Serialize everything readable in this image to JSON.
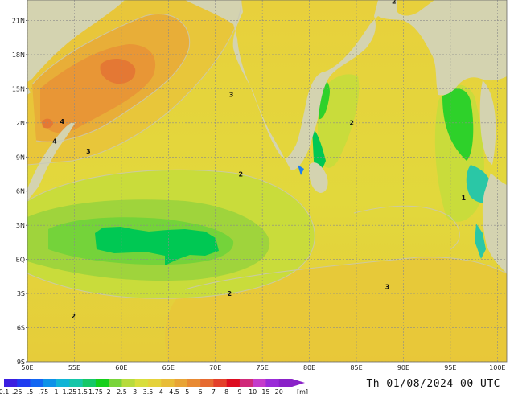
{
  "map": {
    "lat_labels": [
      "21N",
      "18N",
      "15N",
      "12N",
      "9N",
      "6N",
      "3N",
      "EQ",
      "3S",
      "6S",
      "9S"
    ],
    "lon_labels": [
      "50E",
      "55E",
      "60E",
      "65E",
      "70E",
      "75E",
      "80E",
      "85E",
      "90E",
      "95E",
      "100E"
    ],
    "contour_labels": [
      {
        "text": "2",
        "lon": 89.0,
        "lat": 22.5
      },
      {
        "text": "3",
        "lon": 71.7,
        "lat": 14.3
      },
      {
        "text": "2",
        "lon": 84.5,
        "lat": 11.8
      },
      {
        "text": "4",
        "lon": 53.7,
        "lat": 11.9
      },
      {
        "text": "4",
        "lon": 52.9,
        "lat": 10.2
      },
      {
        "text": "3",
        "lon": 56.5,
        "lat": 9.3
      },
      {
        "text": "2",
        "lon": 72.7,
        "lat": 7.3
      },
      {
        "text": "1",
        "lon": 96.4,
        "lat": 5.2
      },
      {
        "text": "2",
        "lon": 71.5,
        "lat": -3.2
      },
      {
        "text": "3",
        "lon": 88.3,
        "lat": -2.6
      },
      {
        "text": "2",
        "lon": 54.9,
        "lat": -5.2
      }
    ],
    "colors": {
      "land": "#d4d3b0",
      "wave_1_to_1_25": "#2ac7a6",
      "wave_1_25_to_1_5": "#00c853",
      "wave_1_5_to_1_75": "#2ed12a",
      "wave_1_75_to_2": "#9fd43c",
      "wave_2_to_2_5": "#c9dc3b",
      "wave_2_5_to_3": "#e4d93a",
      "wave_3_to_3_5": "#e8c63a",
      "wave_3_5_to_4": "#e8ae38",
      "wave_4_to_4_5": "#e89636",
      "wave_4_5_to_5": "#e47834"
    }
  },
  "legend": {
    "values": [
      "0.1",
      ".25",
      ".5",
      ".75",
      "1",
      "1.25",
      "1.5",
      "1.75",
      "2",
      "2.5",
      "3",
      "3.5",
      "4",
      "4.5",
      "5",
      "6",
      "7",
      "8",
      "9",
      "10",
      "15",
      "20"
    ],
    "unit": "[m]",
    "colors": [
      "#3b1ee0",
      "#1f3cf0",
      "#1266f2",
      "#0d92e8",
      "#10b4d6",
      "#15c6a8",
      "#15c868",
      "#14cf1a",
      "#78d43a",
      "#b7db3c",
      "#d8de3c",
      "#e5d23a",
      "#e8bd38",
      "#e8a436",
      "#e88a33",
      "#e66a30",
      "#e3402a",
      "#dd0c20",
      "#d02a7a",
      "#c43ccb",
      "#9a2cd8",
      "#8a22c8"
    ]
  },
  "timestamp": "Th 01/08/2024 00 UTC"
}
